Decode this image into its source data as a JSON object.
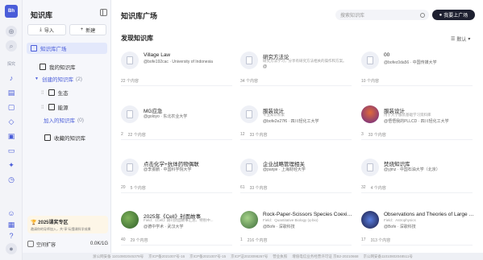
{
  "rail": {
    "logo": "Bh",
    "explore_label": "探究"
  },
  "sidebar": {
    "title": "知识库",
    "import_label": "导入",
    "new_label": "新建",
    "items": [
      {
        "label": "知识库广场"
      },
      {
        "label": "我的知识库"
      },
      {
        "label": "创建的知识库",
        "count": "(2)"
      },
      {
        "label": "生态"
      },
      {
        "label": "能源"
      },
      {
        "label": "加入的知识库",
        "count": "(0)"
      },
      {
        "label": "收藏的知识库"
      }
    ],
    "promo_title": "2025课奖专区",
    "promo_sub": "邀请你的导师加入，共“享”玩懂课科学成果",
    "storage_label": "空间扩容",
    "storage_value": "0.0K/1G"
  },
  "header": {
    "title": "知识库广场",
    "search_placeholder": "搜索知识库",
    "list_button": "我要上广场"
  },
  "section": {
    "title": "发现知识库",
    "sort_label": "默认"
  },
  "cards": [
    {
      "title": "Village Law",
      "desc": "",
      "author": "@bofe192cac · University of Indonesia",
      "stats": [
        "22 个内容"
      ]
    },
    {
      "title": "研究方法论",
      "desc": "研究方法学习，分享有研究方法相关的操作和方案。",
      "author": "@",
      "stats": [
        "34 个内容"
      ]
    },
    {
      "title": "00",
      "desc": "",
      "author": "@bofec0da56 · 中国传媒大学",
      "stats": [
        "10 个内容"
      ]
    },
    {
      "title": "MG应急",
      "desc": "",
      "author": "@goloyo · 东北农业大学",
      "stats": [
        "2",
        "22 个内容"
      ]
    },
    {
      "title": "服装设计",
      "desc": "专业知识积累",
      "author": "@bofe2e27f6 · 四川轻化工大学",
      "stats": [
        "12",
        "33 个内容"
      ]
    },
    {
      "title": "服装设计",
      "desc": "用于大学服装基础学习资料库",
      "author": "@悟悟我的PLLCD · 四川轻化工大学",
      "stats": [
        "3",
        "33 个内容"
      ]
    },
    {
      "title": "点击化学+抗体药物偶联",
      "desc": "",
      "author": "@李振鹏 · 中国科学院大学",
      "stats": [
        "20",
        "5 个内容"
      ]
    },
    {
      "title": "企业战略管理相关",
      "desc": "",
      "author": "@panjie · 上海财经大学",
      "stats": [
        "61",
        "33 个内容"
      ]
    },
    {
      "title": "焚烧知识库",
      "desc": "",
      "author": "@yjmz · 中国石油大学（北京）",
      "stats": [
        "32",
        "4 个内容"
      ]
    },
    {
      "title": "2025年《Cell》封面故事",
      "desc": "Field：《Cell》期刊封面故事汇总、特别中...",
      "author": "@德中学术 · 武汉大学",
      "stats": [
        "40",
        "29 个内容"
      ]
    },
    {
      "title": "Rock-Paper-Scissors Species Coexistence...",
      "desc": "Field：Quantitative Biology (q-bio)",
      "author": "@Bofe · 深歌科技",
      "stats": [
        "1",
        "216 个内容"
      ]
    },
    {
      "title": "Observations and Theories of Large Scal...",
      "desc": "Field：Astrophysics",
      "author": "@Bofe · 深歌科技",
      "stats": [
        "17",
        "313 个内容"
      ]
    }
  ],
  "footer": {
    "items": [
      "浙公网安备 11010802045378号",
      "京ICP备2021007号-16",
      "京ICP备2021007号-15",
      "京ICP证2023098267号",
      "营业执照",
      "增值电信业务经营许可证 京B2-20210668",
      "京公网安备11010802048511号"
    ]
  }
}
